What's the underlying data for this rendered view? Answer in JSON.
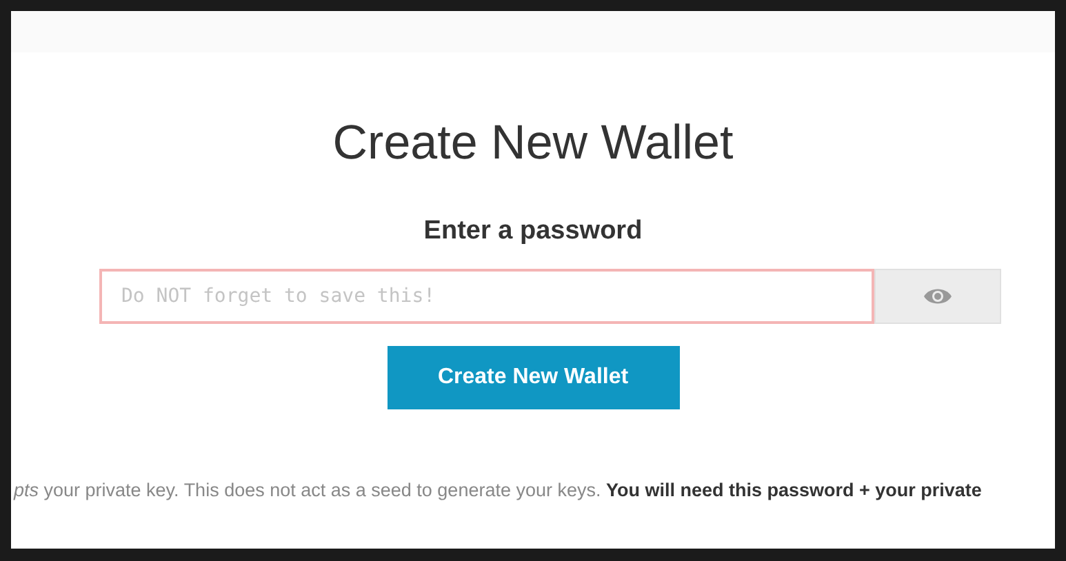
{
  "title": "Create New Wallet",
  "password": {
    "label": "Enter a password",
    "placeholder": "Do NOT forget to save this!"
  },
  "create_button": "Create New Wallet",
  "footer_note": "*pts* your private key. This does not act as a seed to generate your keys. **You will need this password + your private**"
}
